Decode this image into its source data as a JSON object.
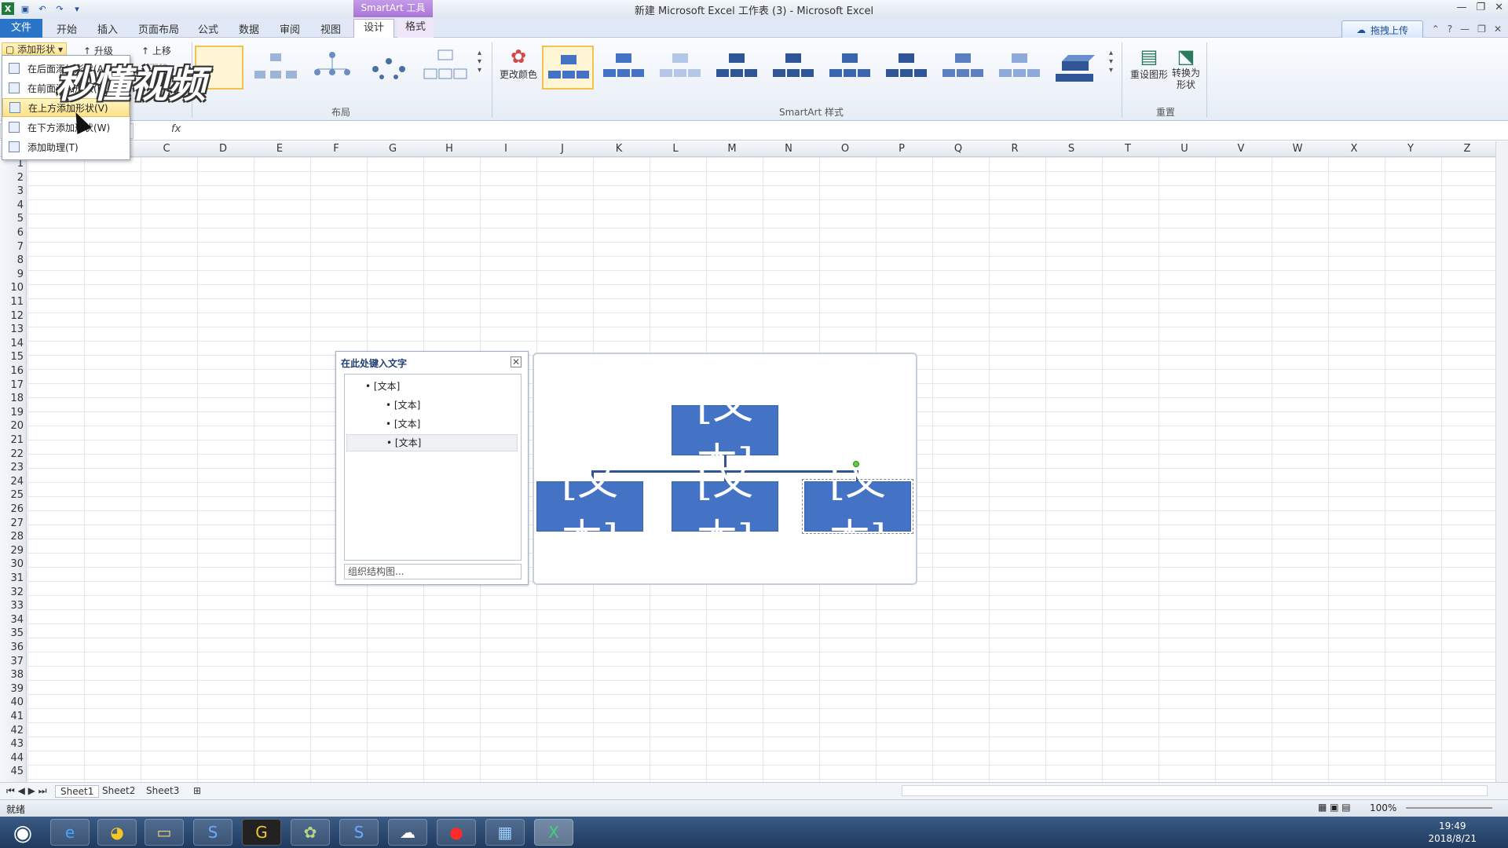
{
  "window": {
    "title": "新建 Microsoft Excel 工作表 (3) - Microsoft Excel",
    "context_tab": "SmartArt 工具"
  },
  "tabs": [
    "开始",
    "插入",
    "页面布局",
    "公式",
    "数据",
    "审阅",
    "视图"
  ],
  "file_tab": "文件",
  "ctx_tabs": [
    "设计",
    "格式"
  ],
  "upload_button": "拖拽上传",
  "ribbon": {
    "create": {
      "add_shape": "添加形状",
      "promote": "升级",
      "move_up": "上移",
      "demote": "下移"
    },
    "layout_group": "布局",
    "styles_group": "SmartArt 样式",
    "change_color": "更改颜色",
    "reset_group": "重置",
    "reset_graphic": "重设图形",
    "convert": "转换为形状"
  },
  "columns": [
    "C",
    "D",
    "E",
    "F",
    "G",
    "H",
    "I",
    "J",
    "K",
    "L",
    "M",
    "N",
    "O",
    "P",
    "Q",
    "R",
    "S",
    "T",
    "U",
    "V",
    "W",
    "X",
    "Y",
    "Z"
  ],
  "rows": [
    "1",
    "2",
    "3",
    "4",
    "5",
    "6",
    "7",
    "8",
    "9",
    "10",
    "11",
    "12",
    "13",
    "14",
    "15",
    "16",
    "17",
    "18",
    "19",
    "20",
    "21",
    "22",
    "23",
    "24",
    "25",
    "26",
    "27",
    "28",
    "29",
    "30",
    "31",
    "32",
    "33",
    "34",
    "35",
    "36",
    "37",
    "38",
    "39",
    "40",
    "41",
    "42",
    "43",
    "44",
    "45"
  ],
  "sheets": [
    "Sheet1",
    "Sheet2",
    "Sheet3"
  ],
  "status": {
    "ready": "就绪",
    "zoom": "100%"
  },
  "text_pane": {
    "title": "在此处键入文字",
    "items": [
      "[文本]",
      "[文本]",
      "[文本]",
      "[文本]"
    ],
    "footer": "组织结构图..."
  },
  "smartart": {
    "top": "[文本]",
    "children": [
      "[文本]",
      "[文本]",
      "[文本]"
    ]
  },
  "add_shape_menu": {
    "items": [
      "在后面添加形状(A)",
      "在前面添加形状(B)",
      "在上方添加形状(V)",
      "在下方添加形状(W)",
      "添加助理(T)"
    ],
    "highlighted": 2
  },
  "watermark": "秒懂视频",
  "clock": {
    "time": "19:49",
    "date": "2018/8/21"
  }
}
